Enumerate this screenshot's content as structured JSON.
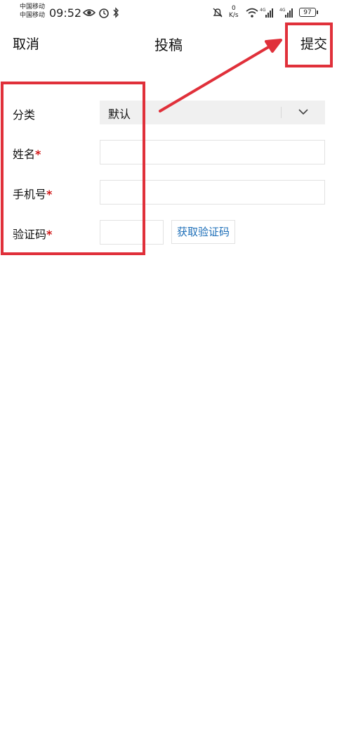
{
  "status_bar": {
    "carrier_1": "中国移动",
    "carrier_2": "中国移动",
    "time": "09:52",
    "net_speed_value": "0",
    "net_speed_unit": "K/s",
    "battery": "97"
  },
  "header": {
    "cancel": "取消",
    "title": "投稿",
    "submit": "提交"
  },
  "form": {
    "category": {
      "label": "分类",
      "value": "默认"
    },
    "name": {
      "label": "姓名",
      "required": "*"
    },
    "phone": {
      "label": "手机号",
      "required": "*"
    },
    "code": {
      "label": "验证码",
      "required": "*",
      "button": "获取验证码"
    }
  },
  "colors": {
    "highlight": "#e0303a",
    "link": "#1e6fb8",
    "required": "#cc0000"
  }
}
